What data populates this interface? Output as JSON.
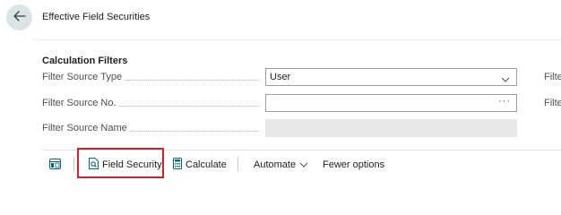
{
  "page": {
    "title": "Effective Field Securities"
  },
  "back_icon": "arrow-left-icon",
  "filters": {
    "section_title": "Calculation Filters",
    "source_type": {
      "label": "Filter Source Type",
      "value": "User"
    },
    "source_no": {
      "label": "Filter Source No.",
      "value": "",
      "lookup": "···"
    },
    "source_name": {
      "label": "Filter Source Name",
      "value": ""
    },
    "right_col_label_1": "Filte",
    "right_col_label_2": "Filte"
  },
  "actions": {
    "field_security": "Field Security",
    "calculate": "Calculate",
    "automate": "Automate",
    "fewer_options": "Fewer options"
  },
  "colors": {
    "accent": "#0b6a75",
    "highlight": "#d42027"
  }
}
